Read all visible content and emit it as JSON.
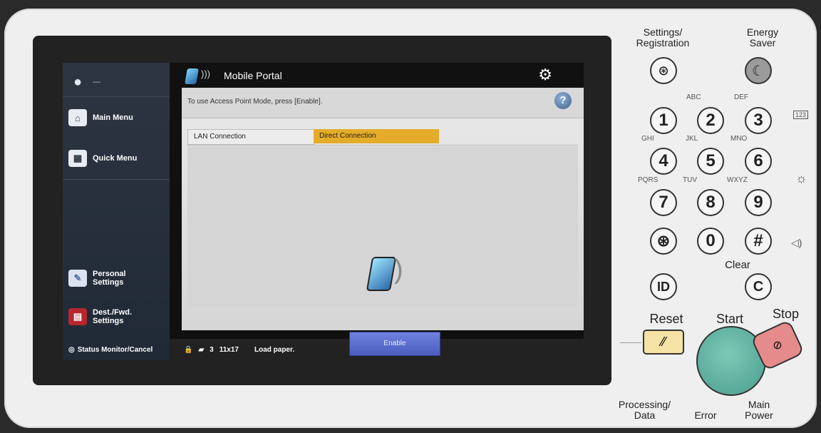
{
  "device": {
    "sidebar": {
      "user_label": "—",
      "main_menu": "Main Menu",
      "quick_menu": "Quick Menu",
      "personal_settings": "Personal\nSettings",
      "dest_fwd_settings": "Dest./Fwd.\nSettings"
    },
    "screen": {
      "title": "Mobile Portal",
      "instruction": "To use Access Point Mode, press [Enable].",
      "tabs": [
        {
          "label": "LAN Connection",
          "selected": false
        },
        {
          "label": "Direct Connection",
          "selected": true
        }
      ],
      "enable_button": "Enable"
    },
    "statusbar": {
      "status_monitor": "Status Monitor/Cancel",
      "tray_number": "3",
      "paper_size": "11x17",
      "message": "Load paper."
    },
    "panel": {
      "settings_registration": "Settings/\nRegistration",
      "energy_saver": "Energy\nSaver",
      "keys": [
        {
          "label": "1"
        },
        {
          "label": "2",
          "letters": "ABC"
        },
        {
          "label": "3",
          "letters": "DEF"
        },
        {
          "label": "4",
          "letters": "GHI"
        },
        {
          "label": "5",
          "letters": "JKL"
        },
        {
          "label": "6",
          "letters": "MNO"
        },
        {
          "label": "7",
          "letters": "PQRS"
        },
        {
          "label": "8",
          "letters": "TUV"
        },
        {
          "label": "9",
          "letters": "WXYZ"
        },
        {
          "label": "⊛"
        },
        {
          "label": "0"
        },
        {
          "label": "#"
        }
      ],
      "side_icons": [
        "123-icon",
        "brightness-icon",
        "volume-icon"
      ],
      "side_icon_label_123": "123",
      "clear": "Clear",
      "id_key": "ID",
      "clear_key": "C",
      "reset": "Reset",
      "start": "Start",
      "stop": "Stop",
      "processing_data": "Processing/\nData",
      "error": "Error",
      "main_power": "Main\nPower"
    },
    "colors": {
      "direct_tab": "#e4ac2a",
      "enable_button": "#5a6cd0",
      "reset_key": "#f6e3a6",
      "start_key": "#63b3a3",
      "stop_key": "#e68b8b"
    }
  }
}
